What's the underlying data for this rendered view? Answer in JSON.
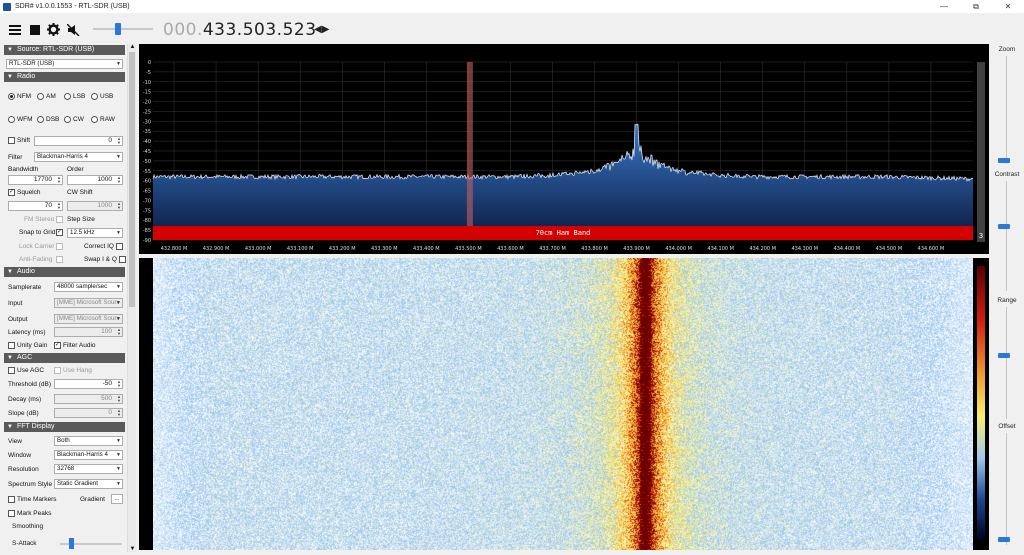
{
  "window": {
    "title": "SDR# v1.0.0.1553 - RTL-SDR (USB)"
  },
  "toolbar": {
    "frequency_dim": "000.",
    "frequency_main": "433.503.523"
  },
  "source": {
    "header": "Source: RTL-SDR (USB)",
    "device": "RTL-SDR (USB)"
  },
  "radio": {
    "header": "Radio",
    "modes": [
      "NFM",
      "AM",
      "LSB",
      "USB",
      "WFM",
      "DSB",
      "CW",
      "RAW"
    ],
    "selected": "NFM",
    "shift_label": "Shift",
    "shift_value": "0",
    "filter_label": "Filter",
    "filter_value": "Blackman-Harris 4",
    "bandwidth_label": "Bandwidth",
    "bandwidth_value": "17700",
    "order_label": "Order",
    "order_value": "1000",
    "squelch_label": "Squelch",
    "cw_shift_label": "CW Shift",
    "squelch_value": "70",
    "cw_shift_value": "1000",
    "fm_stereo_label": "FM Stereo",
    "step_size_label": "Step Size",
    "snap_label": "Snap to Grid",
    "snap_value": "12.5 kHz",
    "lock_carrier_label": "Lock Carrier",
    "correct_iq_label": "Correct IQ",
    "anti_fading_label": "Anti-Fading",
    "swap_iq_label": "Swap I & Q"
  },
  "audio": {
    "header": "Audio",
    "samplerate_label": "Samplerate",
    "samplerate_value": "48000 sample/sec",
    "input_label": "Input",
    "input_value": "[MME] Microsoft Soun",
    "output_label": "Output",
    "output_value": "[MME] Microsoft Soun",
    "latency_label": "Latency (ms)",
    "latency_value": "100",
    "unity_gain_label": "Unity Gain",
    "filter_audio_label": "Filter Audio"
  },
  "agc": {
    "header": "AGC",
    "use_agc_label": "Use AGC",
    "use_hang_label": "Use Hang",
    "threshold_label": "Threshold (dB)",
    "threshold_value": "-50",
    "decay_label": "Decay (ms)",
    "decay_value": "500",
    "slope_label": "Slope (dB)",
    "slope_value": "0"
  },
  "fft": {
    "header": "FFT Display",
    "view_label": "View",
    "view_value": "Both",
    "window_label": "Window",
    "window_value": "Blackman-Harris 4",
    "resolution_label": "Resolution",
    "resolution_value": "32768",
    "spectrum_style_label": "Spectrum Style",
    "spectrum_style_value": "Static Gradient",
    "time_markers_label": "Time Markers",
    "gradient_label": "Gradient",
    "gradient_button": "...",
    "mark_peaks_label": "Mark Peaks",
    "smoothing_label": "Smoothing",
    "s_attack_label": "S-Attack"
  },
  "spectrum": {
    "band_label": "70cm Ham Band",
    "scale_side_label": "3",
    "y_ticks": [
      "0",
      "-5",
      "-10",
      "-15",
      "-20",
      "-25",
      "-30",
      "-35",
      "-40",
      "-45",
      "-50",
      "-55",
      "-60",
      "-65",
      "-70",
      "-75",
      "-80",
      "-85",
      "-90"
    ],
    "x_ticks": [
      "432.800 M",
      "432.900 M",
      "433.000 M",
      "433.100 M",
      "433.200 M",
      "433.300 M",
      "433.400 M",
      "433.500 M",
      "433.600 M",
      "433.700 M",
      "433.800 M",
      "433.900 M",
      "434.000 M",
      "434.100 M",
      "434.200 M",
      "434.300 M",
      "434.400 M",
      "434.500 M",
      "434.600 M"
    ],
    "peak_mhz": 433.9,
    "peak_db": -32,
    "noise_floor_db": -58,
    "tuned_mhz": 433.5035
  },
  "right_panel": {
    "zoom_label": "Zoom",
    "contrast_label": "Contrast",
    "range_label": "Range",
    "offset_label": "Offset"
  },
  "colors": {
    "band_bar": "#d40000",
    "spectrum_fill": "#1a56a8",
    "accent": "#2a78d8"
  }
}
